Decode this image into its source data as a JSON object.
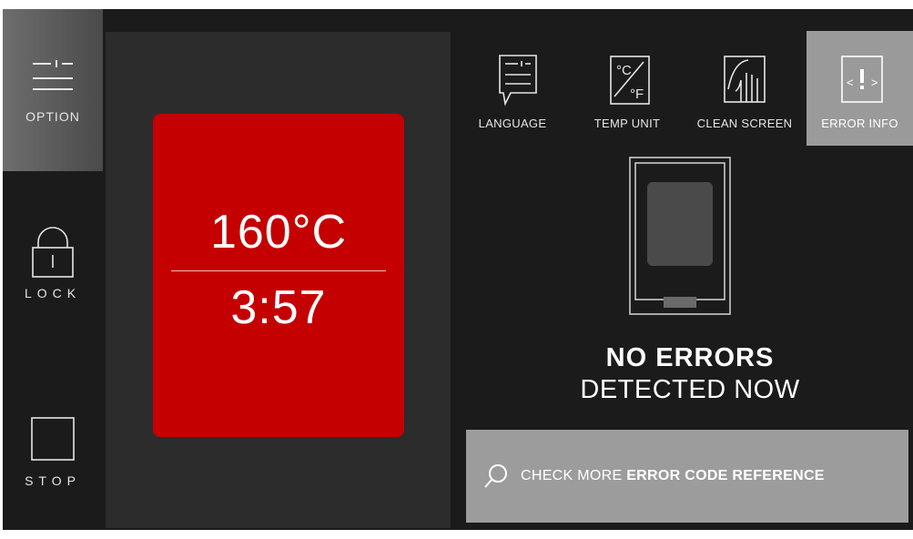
{
  "sidebar": {
    "option_label": "OPTION",
    "lock_label": "LOCK",
    "stop_label": "STOP"
  },
  "status": {
    "temperature": "160°C",
    "time_remaining": "3:57"
  },
  "tools": [
    {
      "label": "LANGUAGE",
      "icon": "language-icon"
    },
    {
      "label": "TEMP UNIT",
      "icon": "temp-unit-icon"
    },
    {
      "label": "CLEAN SCREEN",
      "icon": "clean-screen-icon"
    },
    {
      "label": "ERROR INFO",
      "icon": "error-info-icon"
    }
  ],
  "error_panel": {
    "title_bold": "NO ERRORS",
    "title_light": "DETECTED NOW",
    "check_prefix": "CHECK MORE ",
    "check_bold": "ERROR CODE REFERENCE"
  },
  "colors": {
    "background": "#1b1b1b",
    "panel": "#2c2c2c",
    "status_red": "#c40000",
    "active_gray": "#9a9a9a"
  }
}
